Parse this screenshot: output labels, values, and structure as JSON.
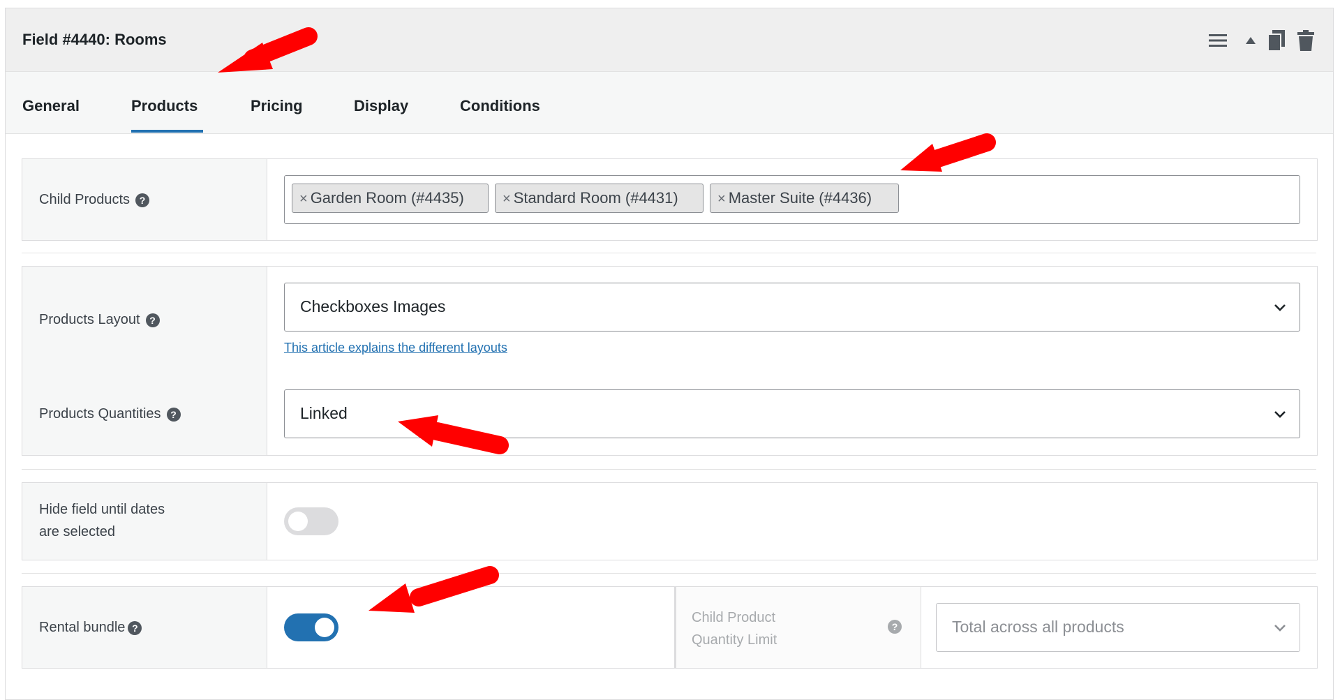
{
  "header": {
    "title": "Field #4440: Rooms",
    "icons": [
      "menu-icon",
      "caret-up-icon",
      "duplicate-icon",
      "trash-icon"
    ]
  },
  "tabs": [
    {
      "label": "General",
      "active": false
    },
    {
      "label": "Products",
      "active": true
    },
    {
      "label": "Pricing",
      "active": false
    },
    {
      "label": "Display",
      "active": false
    },
    {
      "label": "Conditions",
      "active": false
    }
  ],
  "child_products": {
    "label": "Child Products",
    "chips": [
      "Garden Room (#4435)",
      "Standard Room (#4431)",
      "Master Suite (#4436)"
    ],
    "remove_glyph": "×"
  },
  "products_layout": {
    "label": "Products Layout",
    "value": "Checkboxes Images",
    "link": "This article explains the different layouts"
  },
  "products_quantities": {
    "label": "Products Quantities",
    "value": "Linked"
  },
  "hide_field": {
    "label_line1": "Hide field until dates",
    "label_line2": "are selected",
    "on": false
  },
  "rental_bundle": {
    "label": "Rental bundle",
    "on": true,
    "limit_label_line1": "Child Product",
    "limit_label_line2": "Quantity Limit",
    "limit_value": "Total across all products"
  },
  "help_glyph": "?",
  "colors": {
    "accent": "#2271b1",
    "annotation_arrow": "#ff0000",
    "toggle_off": "#dcdcde"
  }
}
